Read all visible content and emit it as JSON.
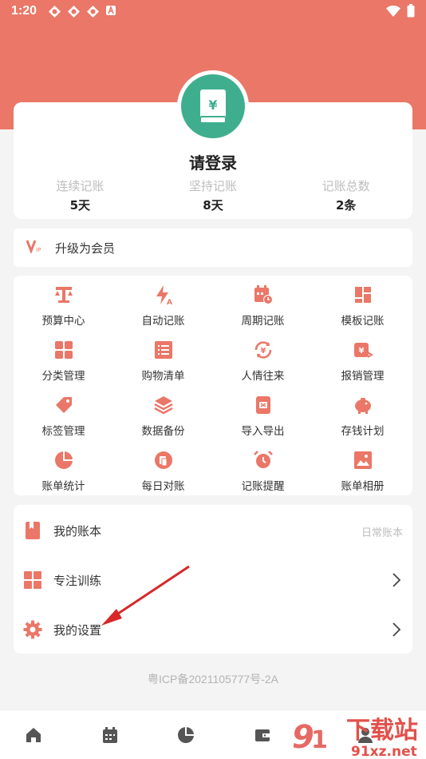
{
  "status_bar": {
    "time": "1:20"
  },
  "profile": {
    "title": "请登录",
    "stats": [
      {
        "label": "连续记账",
        "value": "5天"
      },
      {
        "label": "坚持记账",
        "value": "8天"
      },
      {
        "label": "记账总数",
        "value": "2条"
      }
    ]
  },
  "vip": {
    "label": "升级为会员"
  },
  "features": [
    {
      "label": "预算中心",
      "icon": "scale-icon"
    },
    {
      "label": "自动记账",
      "icon": "lightning-icon"
    },
    {
      "label": "周期记账",
      "icon": "calendar-clock-icon"
    },
    {
      "label": "模板记账",
      "icon": "template-icon"
    },
    {
      "label": "分类管理",
      "icon": "category-grid-icon"
    },
    {
      "label": "购物清单",
      "icon": "list-icon"
    },
    {
      "label": "人情往来",
      "icon": "yen-cycle-icon"
    },
    {
      "label": "报销管理",
      "icon": "reimburse-icon"
    },
    {
      "label": "标签管理",
      "icon": "tag-icon"
    },
    {
      "label": "数据备份",
      "icon": "layers-icon"
    },
    {
      "label": "导入导出",
      "icon": "import-export-icon"
    },
    {
      "label": "存钱计划",
      "icon": "piggy-bank-icon"
    },
    {
      "label": "账单统计",
      "icon": "pie-chart-icon"
    },
    {
      "label": "每日对账",
      "icon": "daily-check-icon"
    },
    {
      "label": "记账提醒",
      "icon": "alarm-clock-icon"
    },
    {
      "label": "账单相册",
      "icon": "photo-album-icon"
    }
  ],
  "menu": {
    "my_books": {
      "label": "我的账本",
      "meta": "日常账本"
    },
    "focus_training": {
      "label": "专注训练"
    },
    "my_settings": {
      "label": "我的设置"
    }
  },
  "footer": {
    "icp": "粤ICP备2021105777号-2A"
  },
  "watermark": {
    "big": "下载站",
    "url": "91xz.net"
  },
  "colors": {
    "accent": "#ea7767",
    "avatar": "#3fae8f"
  }
}
